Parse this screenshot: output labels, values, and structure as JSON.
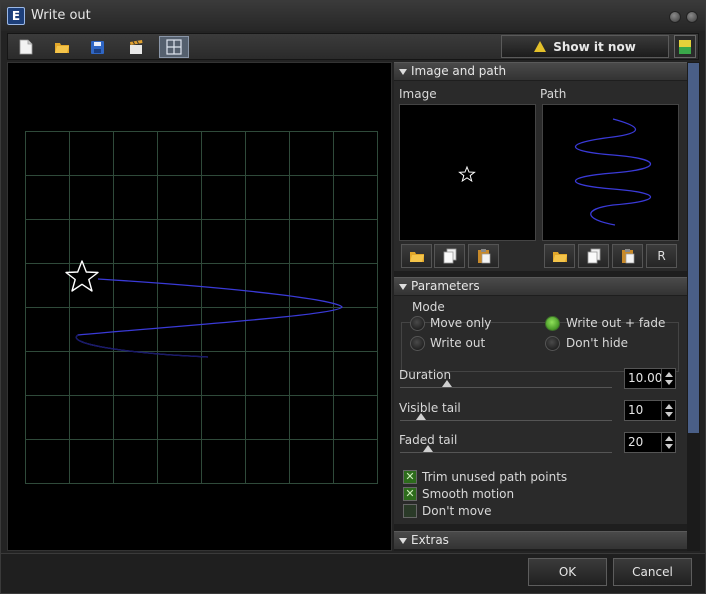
{
  "window": {
    "title": "Write out",
    "app_icon_letter": "E"
  },
  "toolbar": {
    "tools": [
      {
        "icon": "new-document-icon"
      },
      {
        "icon": "open-folder-icon"
      },
      {
        "icon": "save-icon"
      },
      {
        "icon": "clapperboard-icon"
      },
      {
        "icon": "grid-icon",
        "active": true
      }
    ],
    "show_now_label": "Show it now"
  },
  "sections": {
    "image_path": {
      "title": "Image and path",
      "image_label": "Image",
      "path_label": "Path",
      "reset_label": "R"
    },
    "parameters": {
      "title": "Parameters",
      "mode_label": "Mode",
      "modes": [
        {
          "label": "Move only",
          "selected": false
        },
        {
          "label": "Write out + fade",
          "selected": true
        },
        {
          "label": "Write out",
          "selected": false
        },
        {
          "label": "Don't hide",
          "selected": false
        }
      ],
      "duration": {
        "label": "Duration",
        "value": "10.00"
      },
      "visible_tail": {
        "label": "Visible tail",
        "value": "10"
      },
      "faded_tail": {
        "label": "Faded tail",
        "value": "20"
      },
      "checks": [
        {
          "label": "Trim unused path points",
          "checked": true
        },
        {
          "label": "Smooth motion",
          "checked": true
        },
        {
          "label": "Don't move",
          "checked": false
        }
      ]
    },
    "extras": {
      "title": "Extras"
    }
  },
  "dialog": {
    "ok_label": "OK",
    "cancel_label": "Cancel"
  },
  "colors": {
    "path": "#3a3ad8",
    "grid": "#2f4a3a",
    "accent_green": "#3ea020",
    "scroll": "#4a5f87"
  }
}
